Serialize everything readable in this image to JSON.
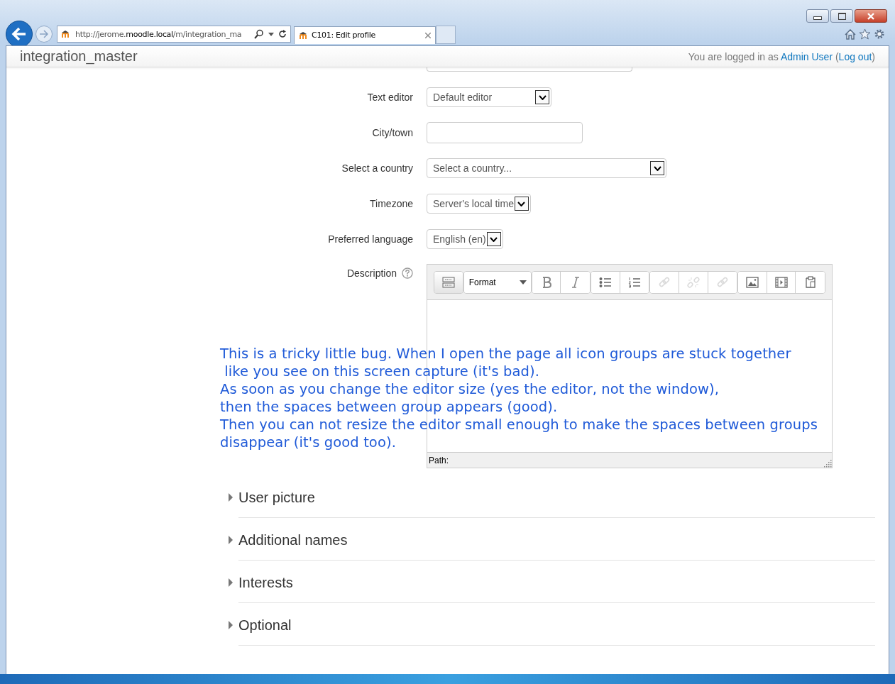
{
  "browser": {
    "url": "http://jerome.**moodle.local**/m/integration_ma",
    "tab_title": "C101: Edit profile"
  },
  "header": {
    "site_name": "integration_master",
    "login": [
      {
        "kind": "text",
        "text": "You are logged in as "
      },
      {
        "kind": "link",
        "text": "Admin User"
      },
      {
        "kind": "text",
        "text": " ("
      },
      {
        "kind": "link",
        "text": "Log out"
      },
      {
        "kind": "text",
        "text": ")"
      }
    ]
  },
  "fields": [
    {
      "label": "Text editor",
      "kind": "select",
      "value": "Default editor"
    },
    {
      "label": "City/town",
      "kind": "text"
    },
    {
      "label": "Select a country",
      "kind": "select",
      "value": "Select a country..."
    },
    {
      "label": "Timezone",
      "kind": "select",
      "value": "Server's local time"
    },
    {
      "label": "Preferred language",
      "kind": "select",
      "value": "English (en)"
    }
  ],
  "description": {
    "label": "Description",
    "toolbar": [
      [
        {
          "kind": "collapse",
          "disabled": false
        }
      ],
      [
        {
          "kind": "format",
          "label": "Format",
          "disabled": false
        }
      ],
      [
        {
          "kind": "bold",
          "disabled": false
        },
        {
          "kind": "italic",
          "disabled": false
        }
      ],
      [
        {
          "kind": "bullets",
          "disabled": false
        },
        {
          "kind": "numbers",
          "disabled": false
        }
      ],
      [
        {
          "kind": "link",
          "disabled": true
        },
        {
          "kind": "unlink",
          "disabled": true
        },
        {
          "kind": "link",
          "disabled": true
        }
      ],
      [
        {
          "kind": "image",
          "disabled": false
        },
        {
          "kind": "media",
          "disabled": false
        },
        {
          "kind": "paste",
          "disabled": false
        }
      ]
    ],
    "path_label": "Path:"
  },
  "annotation": [
    "This is a tricky little bug. When I open the page all icon groups are stuck together",
    " like you see on this screen capture (it's bad).",
    "As soon as you change the editor size (yes the editor, not the window),",
    "then the spaces between group appears (good).",
    "Then you can not resize the editor small enough to make the spaces between groups",
    "disappear (it's good too)."
  ],
  "sections": [
    {
      "title": "User picture",
      "expanded": false
    },
    {
      "title": "Additional names",
      "expanded": false
    },
    {
      "title": "Interests",
      "expanded": false
    },
    {
      "title": "Optional",
      "expanded": false
    }
  ]
}
